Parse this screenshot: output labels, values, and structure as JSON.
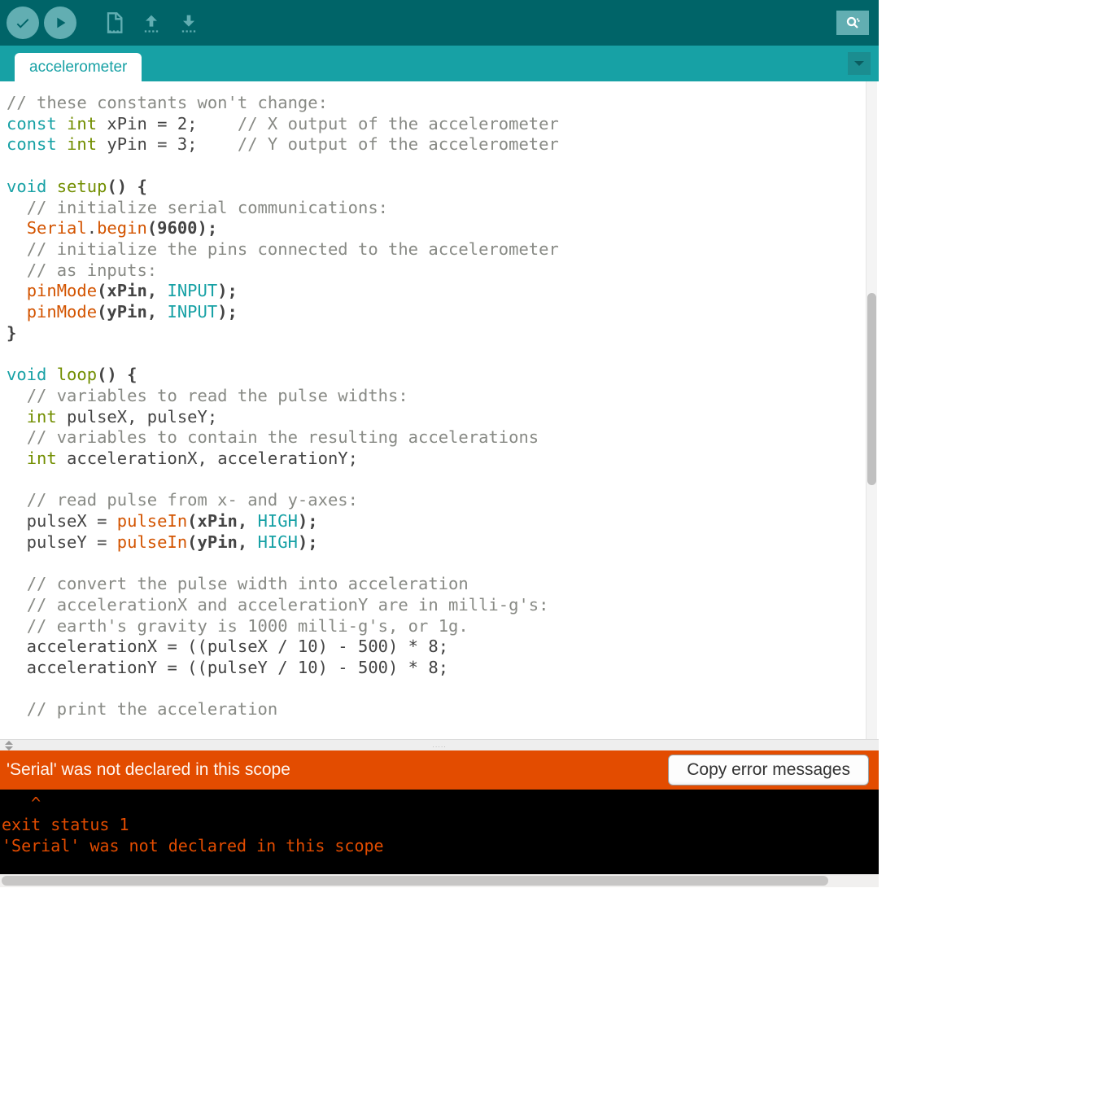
{
  "toolbar": {
    "verify_title": "Verify",
    "upload_title": "Upload",
    "new_title": "New",
    "open_title": "Open",
    "save_title": "Save",
    "serial_title": "Serial Monitor"
  },
  "tab": {
    "name": "accelerometer"
  },
  "code_lines": [
    [
      {
        "t": "// these constants won't change:",
        "c": "cm"
      }
    ],
    [
      {
        "t": "const ",
        "c": "kw"
      },
      {
        "t": "int",
        "c": "ty"
      },
      {
        "t": " xPin = 2;    ",
        "c": ""
      },
      {
        "t": "// X output of the accelerometer",
        "c": "cm"
      }
    ],
    [
      {
        "t": "const ",
        "c": "kw"
      },
      {
        "t": "int",
        "c": "ty"
      },
      {
        "t": " yPin = 3;    ",
        "c": ""
      },
      {
        "t": "// Y output of the accelerometer",
        "c": "cm"
      }
    ],
    [
      {
        "t": "",
        "c": ""
      }
    ],
    [
      {
        "t": "void ",
        "c": "kw"
      },
      {
        "t": "setup",
        "c": "ty"
      },
      {
        "t": "() {",
        "c": "br"
      }
    ],
    [
      {
        "t": "  ",
        "c": ""
      },
      {
        "t": "// initialize serial communications:",
        "c": "cm"
      }
    ],
    [
      {
        "t": "  ",
        "c": ""
      },
      {
        "t": "Serial",
        "c": "fn"
      },
      {
        "t": ".",
        "c": ""
      },
      {
        "t": "begin",
        "c": "fn"
      },
      {
        "t": "(9600);",
        "c": "br"
      }
    ],
    [
      {
        "t": "  ",
        "c": ""
      },
      {
        "t": "// initialize the pins connected to the accelerometer",
        "c": "cm"
      }
    ],
    [
      {
        "t": "  ",
        "c": ""
      },
      {
        "t": "// as inputs:",
        "c": "cm"
      }
    ],
    [
      {
        "t": "  ",
        "c": ""
      },
      {
        "t": "pinMode",
        "c": "fn"
      },
      {
        "t": "(xPin, ",
        "c": "br"
      },
      {
        "t": "INPUT",
        "c": "cn"
      },
      {
        "t": ");",
        "c": "br"
      }
    ],
    [
      {
        "t": "  ",
        "c": ""
      },
      {
        "t": "pinMode",
        "c": "fn"
      },
      {
        "t": "(yPin, ",
        "c": "br"
      },
      {
        "t": "INPUT",
        "c": "cn"
      },
      {
        "t": ");",
        "c": "br"
      }
    ],
    [
      {
        "t": "}",
        "c": "br"
      }
    ],
    [
      {
        "t": "",
        "c": ""
      }
    ],
    [
      {
        "t": "void ",
        "c": "kw"
      },
      {
        "t": "loop",
        "c": "ty"
      },
      {
        "t": "() {",
        "c": "br"
      }
    ],
    [
      {
        "t": "  ",
        "c": ""
      },
      {
        "t": "// variables to read the pulse widths:",
        "c": "cm"
      }
    ],
    [
      {
        "t": "  ",
        "c": ""
      },
      {
        "t": "int",
        "c": "ty"
      },
      {
        "t": " pulseX, pulseY;",
        "c": ""
      }
    ],
    [
      {
        "t": "  ",
        "c": ""
      },
      {
        "t": "// variables to contain the resulting accelerations",
        "c": "cm"
      }
    ],
    [
      {
        "t": "  ",
        "c": ""
      },
      {
        "t": "int",
        "c": "ty"
      },
      {
        "t": " accelerationX, accelerationY;",
        "c": ""
      }
    ],
    [
      {
        "t": "",
        "c": ""
      }
    ],
    [
      {
        "t": "  ",
        "c": ""
      },
      {
        "t": "// read pulse from x- and y-axes:",
        "c": "cm"
      }
    ],
    [
      {
        "t": "  pulseX = ",
        "c": ""
      },
      {
        "t": "pulseIn",
        "c": "fn"
      },
      {
        "t": "(xPin, ",
        "c": "br"
      },
      {
        "t": "HIGH",
        "c": "cn"
      },
      {
        "t": ");",
        "c": "br"
      }
    ],
    [
      {
        "t": "  pulseY = ",
        "c": ""
      },
      {
        "t": "pulseIn",
        "c": "fn"
      },
      {
        "t": "(yPin, ",
        "c": "br"
      },
      {
        "t": "HIGH",
        "c": "cn"
      },
      {
        "t": ");",
        "c": "br"
      }
    ],
    [
      {
        "t": "",
        "c": ""
      }
    ],
    [
      {
        "t": "  ",
        "c": ""
      },
      {
        "t": "// convert the pulse width into acceleration",
        "c": "cm"
      }
    ],
    [
      {
        "t": "  ",
        "c": ""
      },
      {
        "t": "// accelerationX and accelerationY are in milli-g's:",
        "c": "cm"
      }
    ],
    [
      {
        "t": "  ",
        "c": ""
      },
      {
        "t": "// earth's gravity is 1000 milli-g's, or 1g.",
        "c": "cm"
      }
    ],
    [
      {
        "t": "  accelerationX = ((pulseX / 10) - 500) * 8;",
        "c": ""
      }
    ],
    [
      {
        "t": "  accelerationY = ((pulseY / 10) - 500) * 8;",
        "c": ""
      }
    ],
    [
      {
        "t": "",
        "c": ""
      }
    ],
    [
      {
        "t": "  ",
        "c": ""
      },
      {
        "t": "// print the acceleration",
        "c": "cm"
      }
    ]
  ],
  "error": {
    "summary": "'Serial' was not declared in this scope",
    "copy_label": "Copy error messages"
  },
  "console_lines": [
    "   ^",
    "exit status 1",
    "'Serial' was not declared in this scope"
  ]
}
